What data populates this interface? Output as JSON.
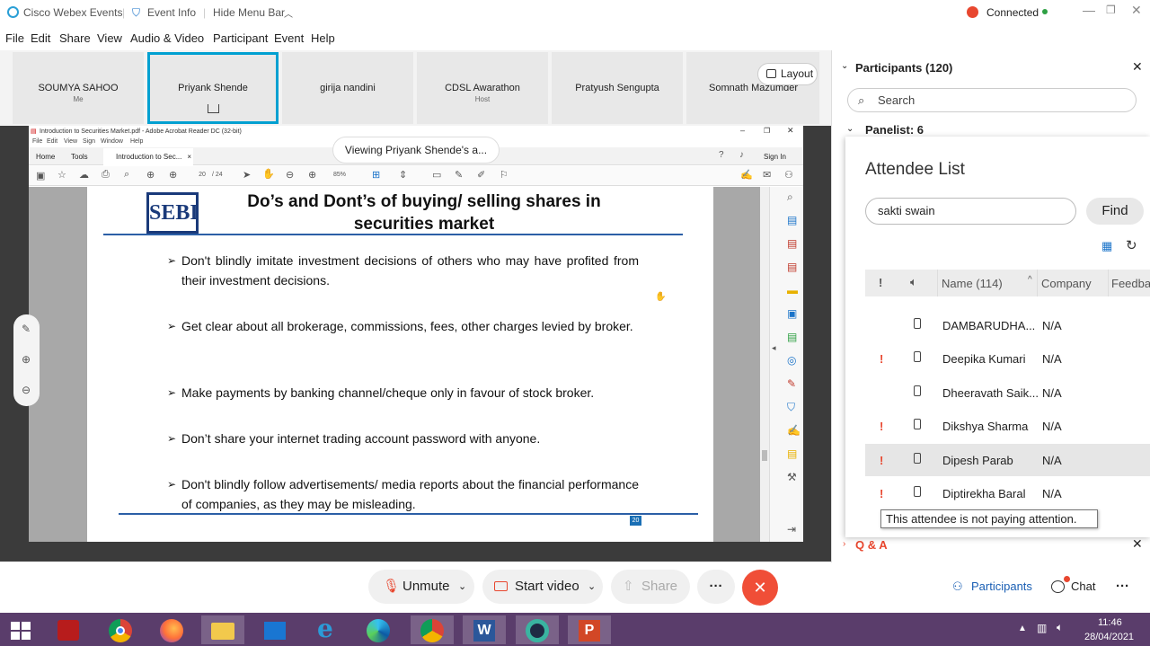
{
  "titlebar": {
    "app": "Cisco Webex Events",
    "event_info": "Event Info",
    "hide_menu": "Hide Menu Bar",
    "status": "Connected"
  },
  "menu": [
    "File",
    "Edit",
    "Share",
    "View",
    "Audio & Video",
    "Participant",
    "Event",
    "Help"
  ],
  "tiles": [
    {
      "name": "SOUMYA SAHOO",
      "sub": "Me"
    },
    {
      "name": "Priyank Shende",
      "sub": ""
    },
    {
      "name": "girija nandini",
      "sub": ""
    },
    {
      "name": "CDSL Awarathon",
      "sub": "Host"
    },
    {
      "name": "Pratyush Sengupta",
      "sub": ""
    },
    {
      "name": "Somnath Mazumder",
      "sub": ""
    }
  ],
  "layout_label": "Layout",
  "viewing_label": "Viewing Priyank Shende's a...",
  "acrobat": {
    "title": "Introduction to Securities Market.pdf - Adobe Acrobat Reader DC (32-bit)",
    "menu": [
      "File",
      "Edit",
      "View",
      "Sign",
      "Window",
      "Help"
    ],
    "tabs": [
      "Home",
      "Tools",
      "Introduction to Sec..."
    ],
    "sign_in": "Sign In",
    "page_current": "20",
    "page_total": "/ 24",
    "zoom": "85%"
  },
  "slide": {
    "logo": "SEBI",
    "title_line1": "Do’s and Dont’s of buying/ selling shares in",
    "title_line2": "securities market",
    "bullets": [
      "Don't blindly imitate investment decisions of others who may have profited from their investment decisions.",
      "Get clear about all brokerage, commissions, fees, other charges levied by broker.",
      "Make payments by banking channel/cheque only in favour of stock broker.",
      "Don’t share your internet trading account password with anyone.",
      "Don't blindly follow advertisements/ media reports about the financial performance of companies, as they may be misleading."
    ],
    "page_num": "20"
  },
  "participants": {
    "header": "Participants (120)",
    "search_placeholder": "Search",
    "panelist": "Panelist: 6",
    "qa": "Q & A"
  },
  "attendee": {
    "title": "Attendee List",
    "search_value": "sakti swain",
    "find": "Find",
    "col_name": "Name (114)",
    "col_company": "Company",
    "col_feedback": "Feedba",
    "rows": [
      {
        "name": "DAMBARUDHA...",
        "company": "N/A",
        "flag": ""
      },
      {
        "name": "Deepika Kumari",
        "company": "N/A",
        "flag": "!"
      },
      {
        "name": "Dheeravath Saik...",
        "company": "N/A",
        "flag": ""
      },
      {
        "name": "Dikshya Sharma",
        "company": "N/A",
        "flag": "!"
      },
      {
        "name": "Dipesh Parab",
        "company": "N/A",
        "flag": "!"
      },
      {
        "name": "Diptirekha Baral",
        "company": "N/A",
        "flag": "!"
      }
    ],
    "tooltip": "This attendee is not paying attention."
  },
  "controls": {
    "unmute": "Unmute",
    "start_video": "Start video",
    "share": "Share",
    "more": "···",
    "participants": "Participants",
    "chat": "Chat"
  },
  "taskbar": {
    "time": "11:46",
    "date": "28/04/2021"
  },
  "colors": {
    "accent": "#00a0d1",
    "end": "#f04e37",
    "taskbar": "#5a3d6b",
    "alert": "#e8472f"
  }
}
